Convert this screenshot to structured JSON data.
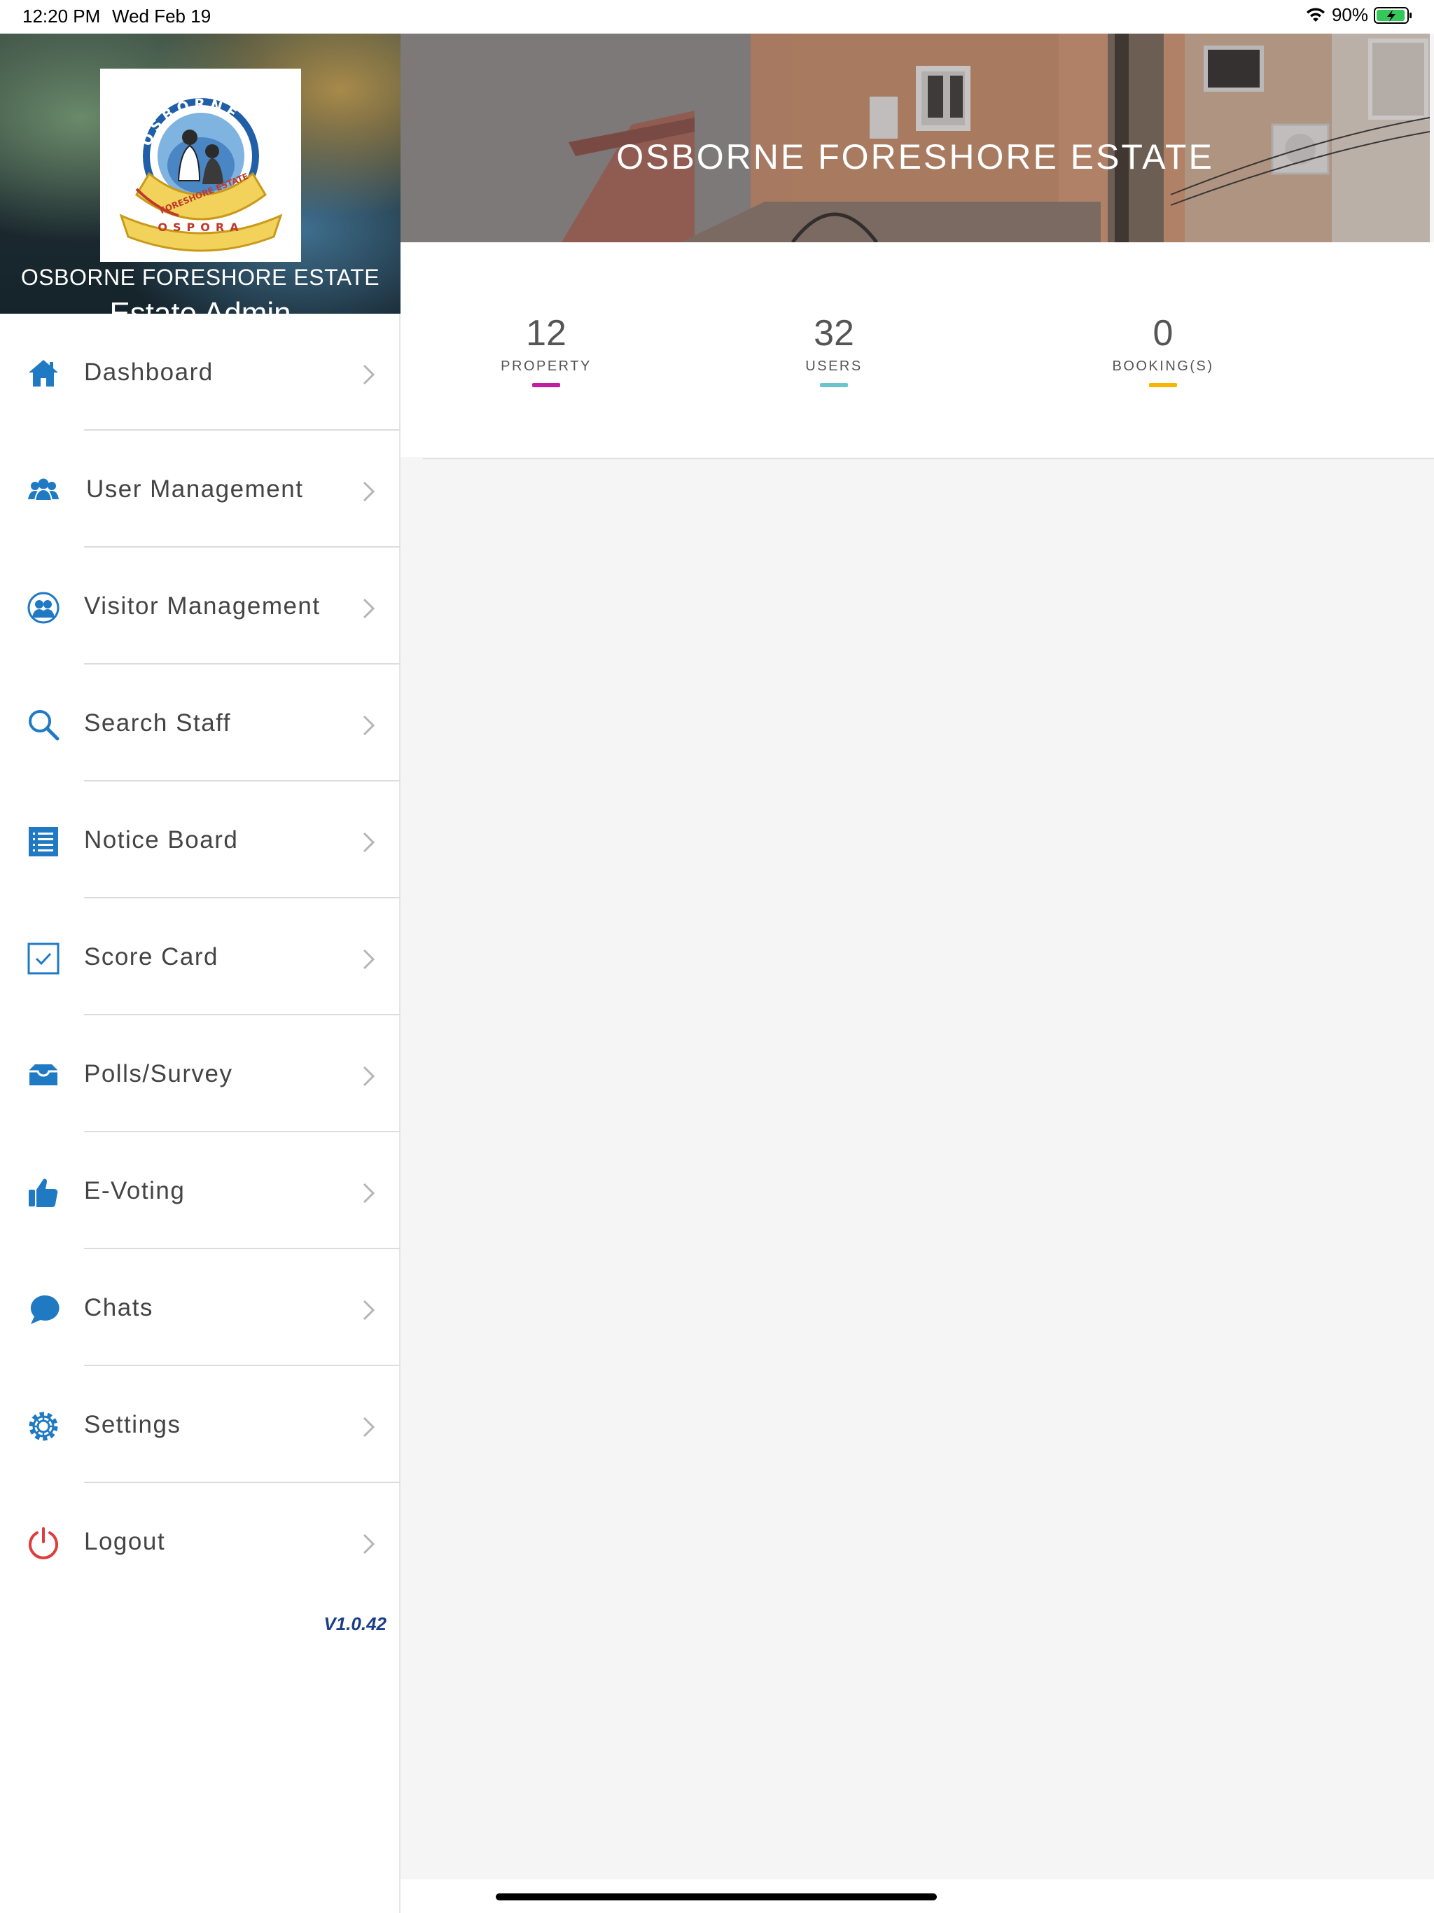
{
  "status_bar": {
    "time": "12:20 PM",
    "date": "Wed Feb 19",
    "battery": "90%"
  },
  "sidebar": {
    "estate_name": "OSBORNE FORESHORE ESTATE",
    "role": "Estate Admin",
    "logo": {
      "top_text": "OSBORNE",
      "ribbon_text": "FORESHORE ESTATE",
      "bottom_text": "OSPORA"
    },
    "items": [
      {
        "label": "Dashboard",
        "icon": "home-icon"
      },
      {
        "label": "User Management",
        "icon": "users-icon"
      },
      {
        "label": "Visitor Management",
        "icon": "visitors-icon"
      },
      {
        "label": "Search Staff",
        "icon": "search-icon"
      },
      {
        "label": "Notice Board",
        "icon": "notice-list-icon"
      },
      {
        "label": "Score Card",
        "icon": "checkbox-icon"
      },
      {
        "label": "Polls/Survey",
        "icon": "inbox-icon"
      },
      {
        "label": "E-Voting",
        "icon": "thumbs-up-icon"
      },
      {
        "label": "Chats",
        "icon": "chat-icon"
      },
      {
        "label": "Settings",
        "icon": "gear-icon"
      },
      {
        "label": "Logout",
        "icon": "power-icon"
      }
    ],
    "version": "V1.0.42"
  },
  "banner": {
    "title": "OSBORNE FORESHORE ESTATE"
  },
  "stats": [
    {
      "value": "12",
      "label": "PROPERTY",
      "color": "#c21ea3"
    },
    {
      "value": "32",
      "label": "USERS",
      "color": "#6cc5c9"
    },
    {
      "value": "0",
      "label": "BOOKING(S)",
      "color": "#f5b700"
    }
  ],
  "colors": {
    "accent": "#1f7ac3",
    "logout": "#e03c3c",
    "version": "#1a3d8a"
  }
}
